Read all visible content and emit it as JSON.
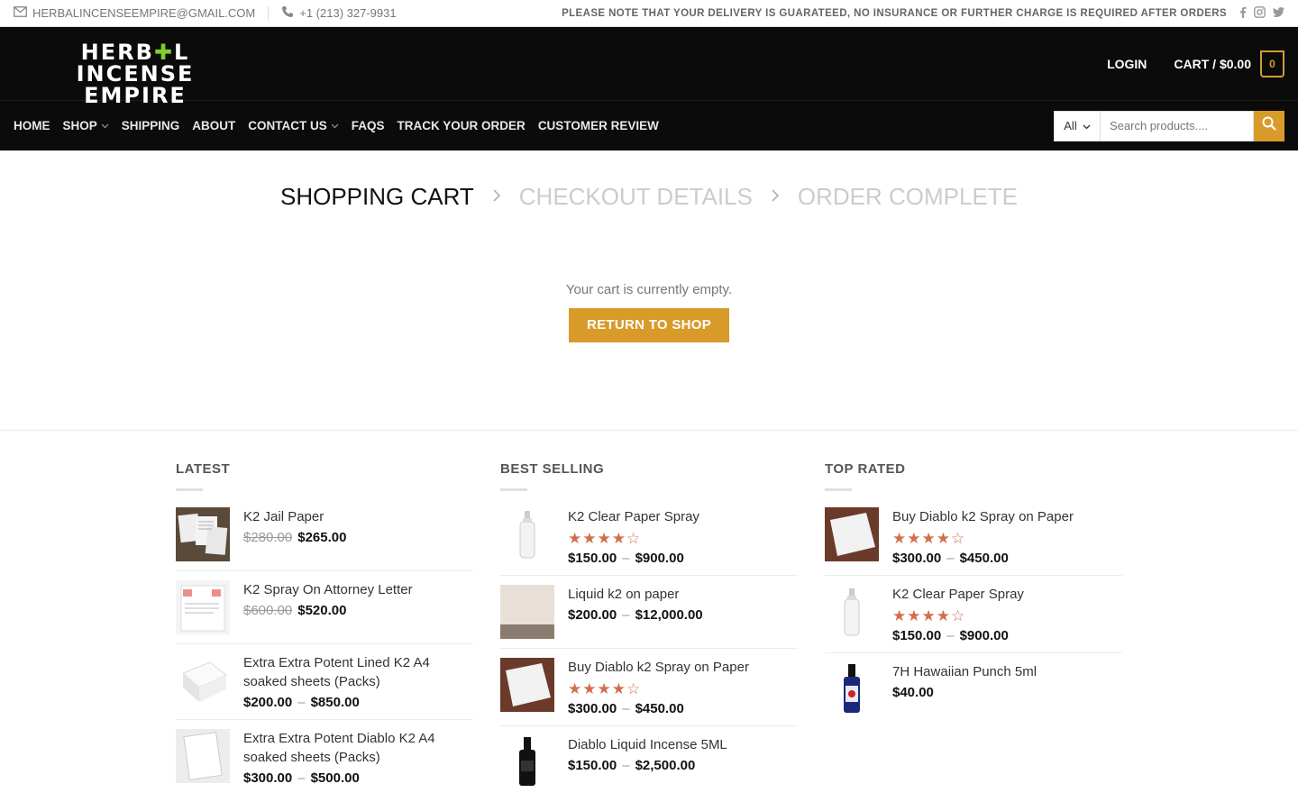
{
  "topbar": {
    "email": "HERBALINCENSEEMPIRE@GMAIL.COM",
    "phone": "+1 (213) 327-9931",
    "notice": "PLEASE NOTE THAT YOUR DELIVERY IS GUARATEED, NO INSURANCE OR FURTHER CHARGE IS REQUIRED AFTER ORDERS",
    "social": [
      "facebook-icon",
      "instagram-icon",
      "twitter-icon"
    ]
  },
  "header": {
    "logo_line1": "HERB",
    "logo_line1b": "L INCENSE",
    "logo_line2": "EMPIRE",
    "login": "LOGIN",
    "cart_label": "CART / $0.00",
    "cart_count": "0"
  },
  "nav": {
    "items": [
      {
        "label": "HOME",
        "dropdown": false
      },
      {
        "label": "SHOP",
        "dropdown": true
      },
      {
        "label": "SHIPPING",
        "dropdown": false
      },
      {
        "label": "ABOUT",
        "dropdown": false
      },
      {
        "label": "CONTACT US",
        "dropdown": true
      },
      {
        "label": "FAQS",
        "dropdown": false
      },
      {
        "label": "TRACK YOUR ORDER",
        "dropdown": false
      },
      {
        "label": "CUSTOMER REVIEW",
        "dropdown": false
      }
    ],
    "search": {
      "category": "All",
      "placeholder": "Search products...."
    }
  },
  "steps": {
    "step1": "SHOPPING CART",
    "step2": "CHECKOUT DETAILS",
    "step3": "ORDER COMPLETE"
  },
  "empty": {
    "message": "Your cart is currently empty.",
    "button": "RETURN TO SHOP"
  },
  "colors": {
    "accent": "#d89b2a",
    "star": "#d26e4b",
    "header_bg": "#0b0b0b"
  },
  "widgets": {
    "latest": {
      "title": "LATEST",
      "products": [
        {
          "name": "K2 Jail Paper",
          "old_price": "$280.00",
          "price": "$265.00"
        },
        {
          "name": "K2 Spray On Attorney Letter",
          "old_price": "$600.00",
          "price": "$520.00"
        },
        {
          "name": "Extra Extra Potent Lined K2 A4 soaked sheets (Packs)",
          "price_min": "$200.00",
          "price_max": "$850.00"
        },
        {
          "name": "Extra Extra Potent Diablo K2 A4 soaked sheets (Packs)",
          "price_min": "$300.00",
          "price_max": "$500.00"
        }
      ]
    },
    "best_selling": {
      "title": "BEST SELLING",
      "products": [
        {
          "name": "K2 Clear Paper Spray",
          "rating": 4,
          "price_min": "$150.00",
          "price_max": "$900.00"
        },
        {
          "name": "Liquid k2 on paper",
          "price_min": "$200.00",
          "price_max": "$12,000.00"
        },
        {
          "name": "Buy Diablo k2 Spray on Paper",
          "rating": 4,
          "price_min": "$300.00",
          "price_max": "$450.00"
        },
        {
          "name": "Diablo Liquid Incense 5ML",
          "price_min": "$150.00",
          "price_max": "$2,500.00"
        }
      ]
    },
    "top_rated": {
      "title": "TOP RATED",
      "products": [
        {
          "name": "Buy Diablo k2 Spray on Paper",
          "rating": 4,
          "price_min": "$300.00",
          "price_max": "$450.00"
        },
        {
          "name": "K2 Clear Paper Spray",
          "rating": 4,
          "price_min": "$150.00",
          "price_max": "$900.00"
        },
        {
          "name": "7H Hawaiian Punch 5ml",
          "price": "$40.00"
        }
      ]
    }
  }
}
